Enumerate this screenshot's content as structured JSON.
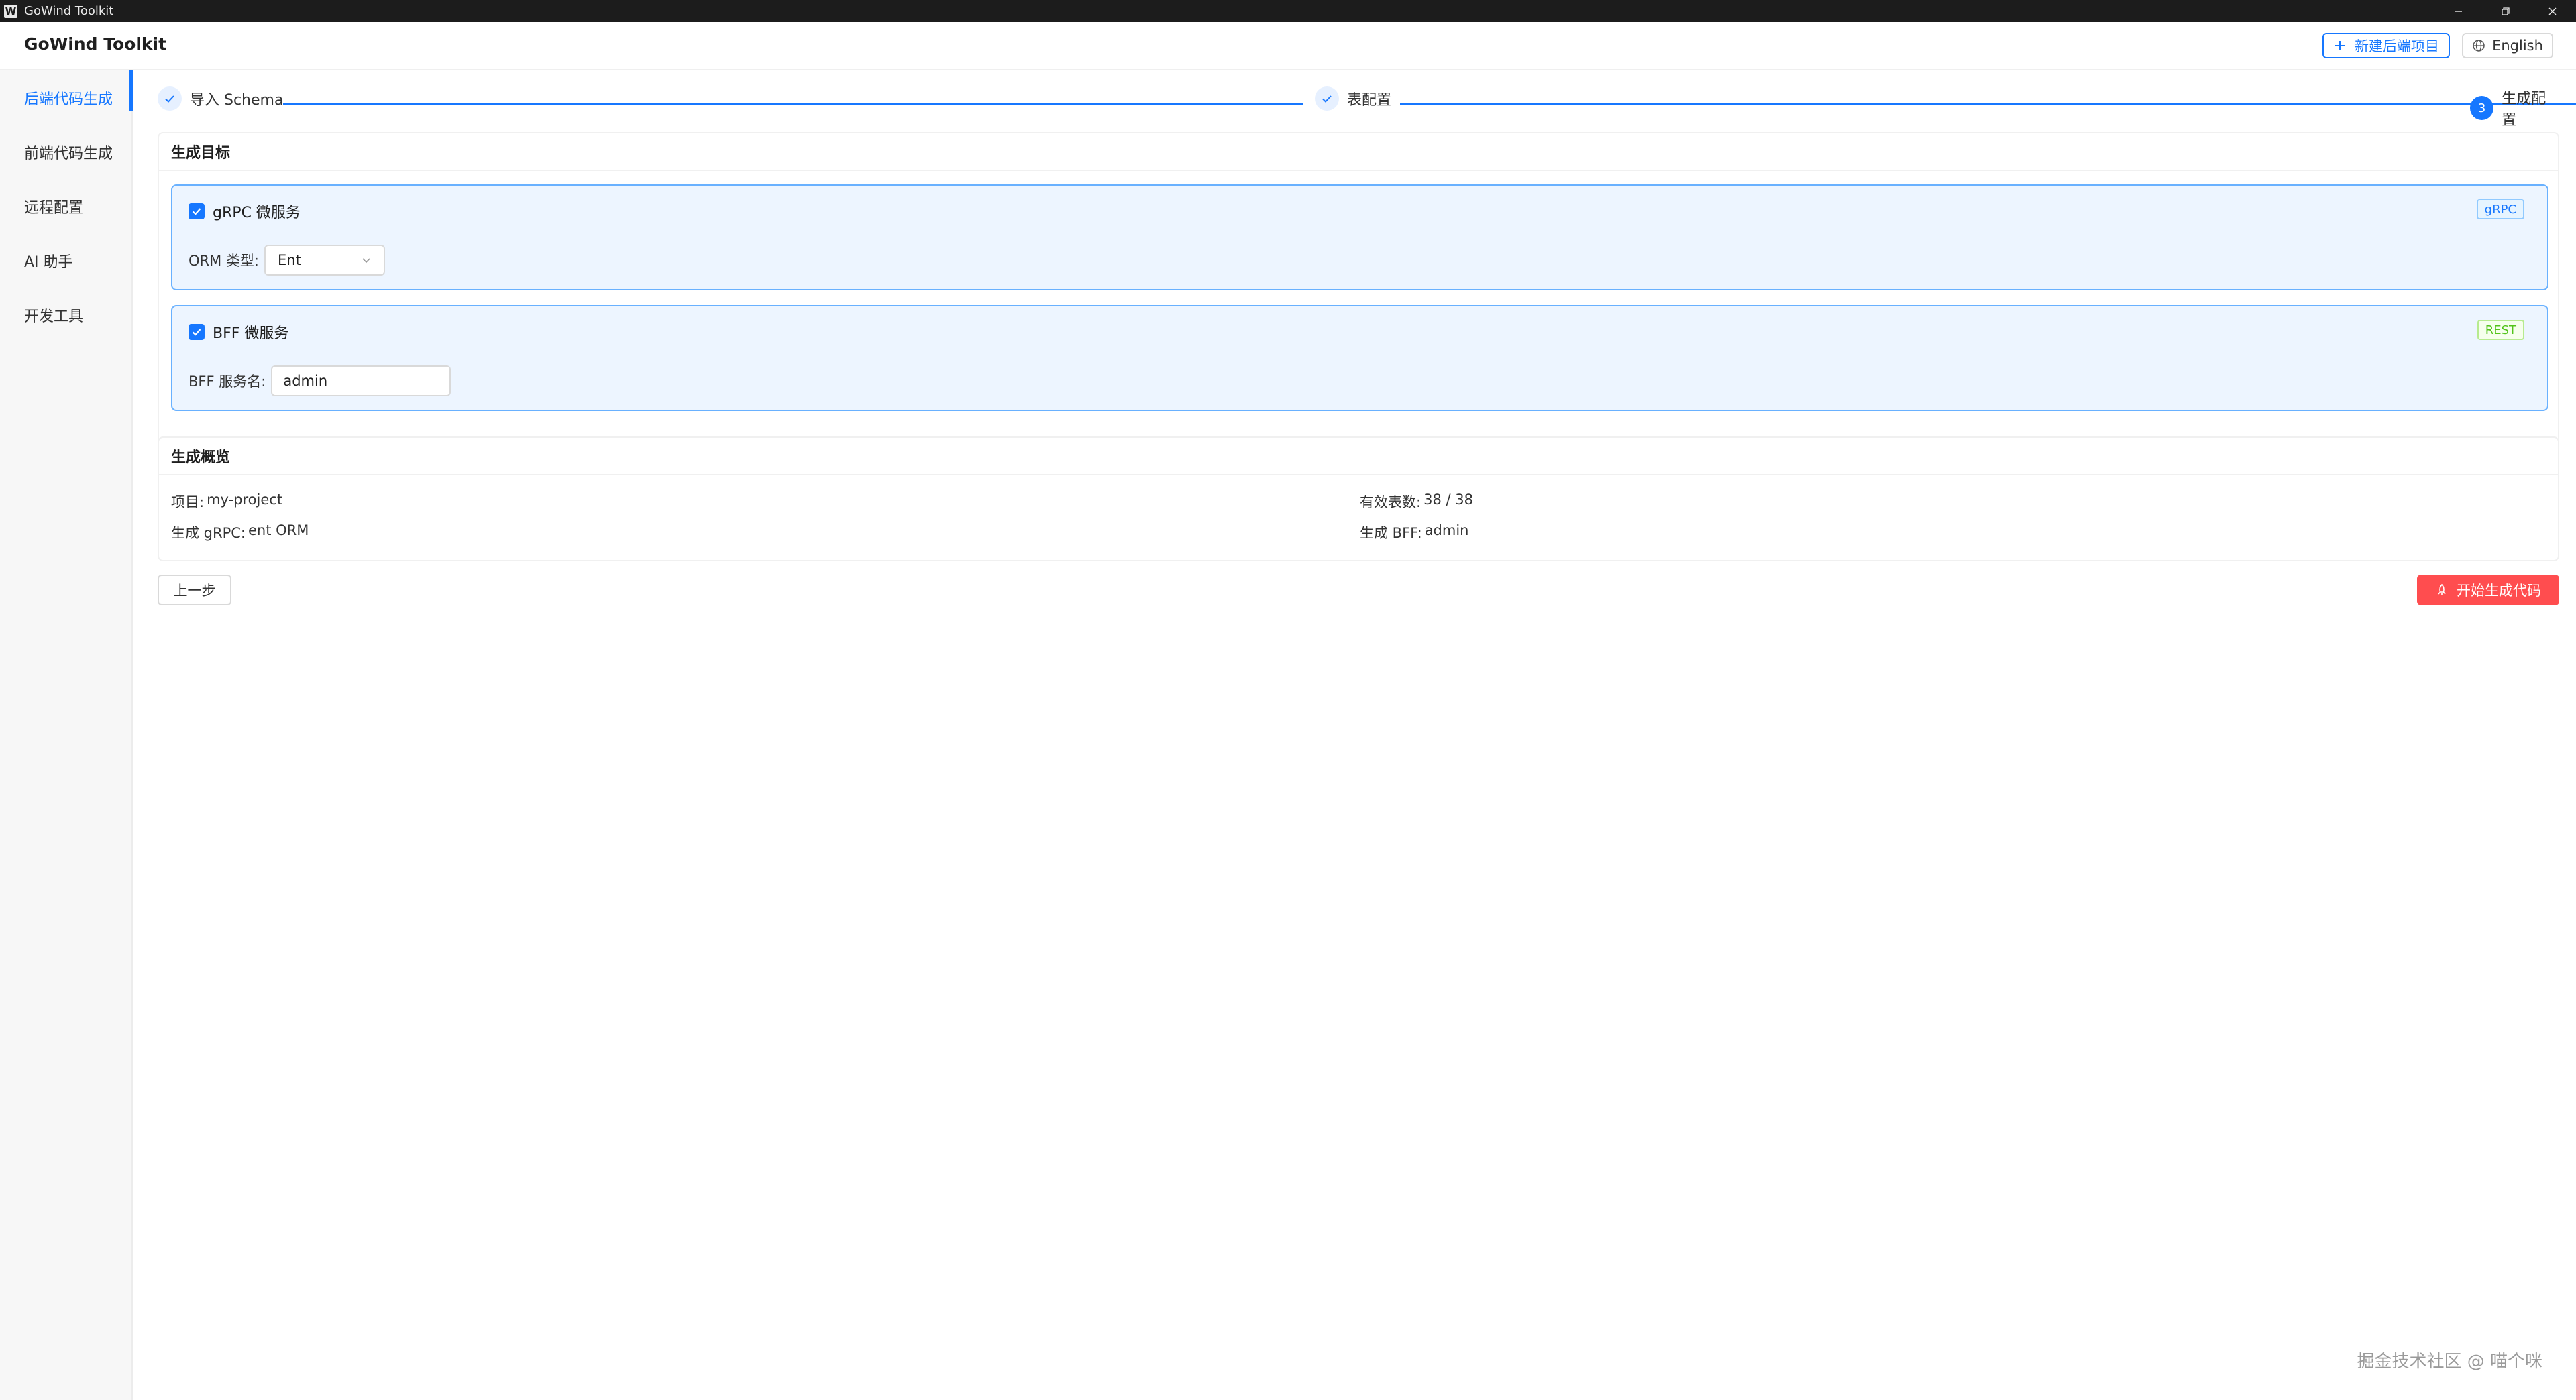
{
  "window": {
    "title": "GoWind Toolkit",
    "logo_letter": "W"
  },
  "header": {
    "app_name": "GoWind Toolkit",
    "new_project_label": "新建后端项目",
    "language_label": "English"
  },
  "sidebar": {
    "items": [
      {
        "label": "后端代码生成",
        "active": true
      },
      {
        "label": "前端代码生成"
      },
      {
        "label": "远程配置"
      },
      {
        "label": "AI 助手"
      },
      {
        "label": "开发工具"
      }
    ]
  },
  "steps": [
    {
      "label": "导入 Schema",
      "status": "done"
    },
    {
      "label": "表配置",
      "status": "done"
    },
    {
      "label": "生成配置",
      "status": "current",
      "number": "3"
    }
  ],
  "targets": {
    "title": "生成目标",
    "grpc": {
      "label": "gRPC 微服务",
      "checked": true,
      "tag": "gRPC",
      "orm_label": "ORM 类型:",
      "orm_value": "Ent"
    },
    "bff": {
      "label": "BFF 微服务",
      "checked": true,
      "tag": "REST",
      "name_label": "BFF 服务名:",
      "name_value": "admin"
    }
  },
  "summary": {
    "title": "生成概览",
    "project_label": "项目:",
    "project_value": "my-project",
    "tables_label": "有效表数:",
    "tables_value": "38 / 38",
    "grpc_label": "生成 gRPC:",
    "grpc_value": "ent ORM",
    "bff_label": "生成 BFF:",
    "bff_value": "admin"
  },
  "actions": {
    "prev_label": "上一步",
    "start_label": "开始生成代码"
  },
  "watermark": "掘金技术社区 @ 喵个咪",
  "colors": {
    "primary": "#1677ff",
    "danger": "#ff4d4f",
    "target_bg": "#edf5ff",
    "target_border": "#69b1ff"
  }
}
